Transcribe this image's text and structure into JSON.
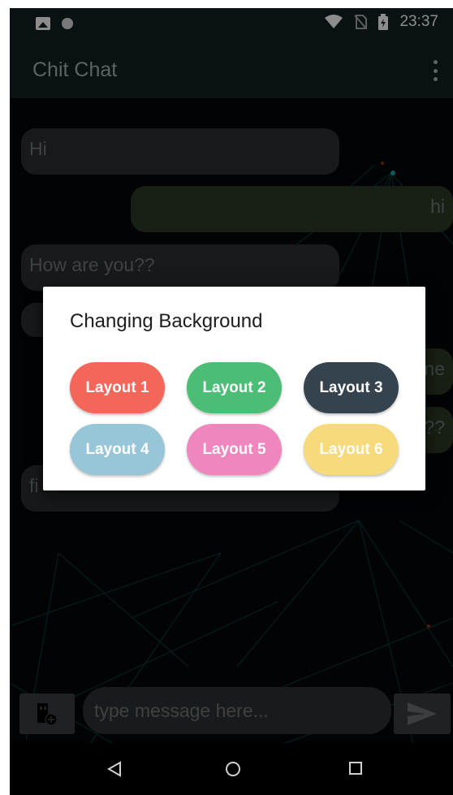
{
  "status_bar": {
    "time": "23:37"
  },
  "app_bar": {
    "title": "Chit Chat"
  },
  "messages": [
    {
      "direction": "received",
      "text": "Hi"
    },
    {
      "direction": "sent",
      "text": "hi"
    },
    {
      "direction": "received",
      "text": "How are you??"
    },
    {
      "direction": "received",
      "text": ""
    },
    {
      "direction": "sent",
      "text": "ne"
    },
    {
      "direction": "sent",
      "text": "??"
    },
    {
      "direction": "received",
      "text": "fi"
    }
  ],
  "composer": {
    "placeholder": "type message here..."
  },
  "dialog": {
    "title": "Changing Background",
    "buttons": [
      {
        "label": "Layout 1",
        "color": "#f2675a"
      },
      {
        "label": "Layout 2",
        "color": "#4bbd74"
      },
      {
        "label": "Layout 3",
        "color": "#34434d"
      },
      {
        "label": "Layout 4",
        "color": "#98c6d9"
      },
      {
        "label": "Layout 5",
        "color": "#ef86bd"
      },
      {
        "label": "Layout 6",
        "color": "#f7da7b"
      }
    ]
  },
  "icons": {
    "status_left": [
      "image-icon",
      "circle-dot-icon"
    ],
    "status_right": [
      "wifi-icon",
      "no-sim-icon",
      "battery-icon"
    ],
    "app_bar": "overflow-menu-icon",
    "composer_left": "attach-layout-icon",
    "composer_right": "send-icon",
    "nav": [
      "back-icon",
      "home-icon",
      "recents-icon"
    ]
  }
}
